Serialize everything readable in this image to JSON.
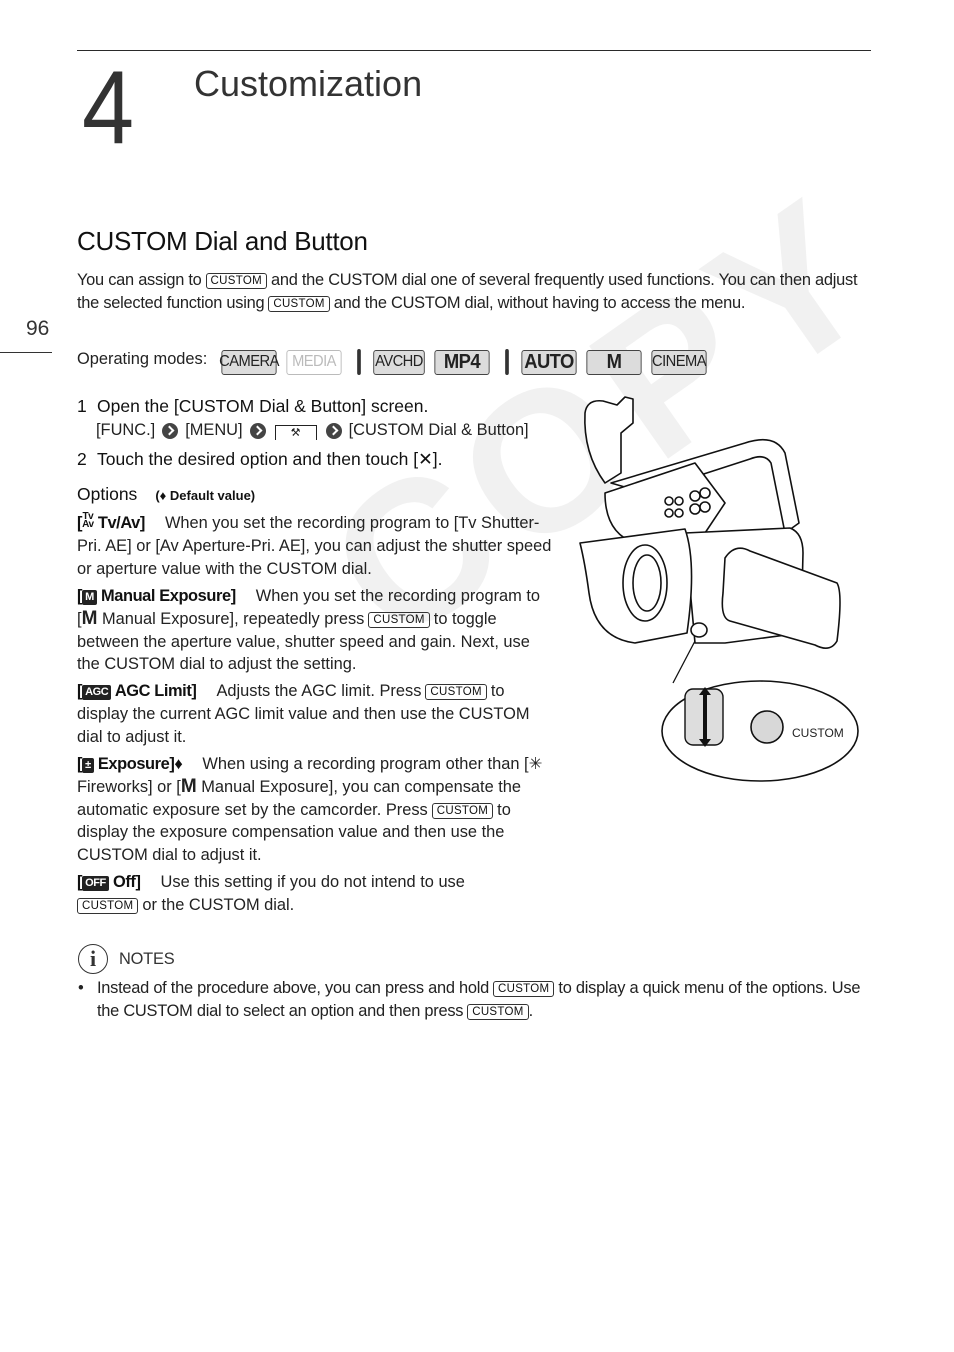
{
  "header": {
    "chapter_number": "4",
    "chapter_title": "Customization",
    "page_number": "96"
  },
  "section": {
    "title": "CUSTOM Dial and Button",
    "intro": {
      "part1": "You can assign to",
      "button": "CUSTOM",
      "part2": "and the CUSTOM dial one of several frequently used functions. You can then adjust the selected function using",
      "part3": "and the CUSTOM dial, without having to access the menu."
    }
  },
  "operating_modes": {
    "label": "Operating modes:",
    "modes": [
      {
        "label": "CAMERA",
        "active": true
      },
      {
        "label": "MEDIA",
        "active": false
      },
      {
        "label": "AVCHD",
        "active": true
      },
      {
        "label": "MP4",
        "active": true
      },
      {
        "label": "AUTO",
        "active": true
      },
      {
        "label": "M",
        "active": true
      },
      {
        "label": "CINEMA",
        "active": true
      }
    ]
  },
  "steps": [
    {
      "number": "1",
      "text": "Open the [CUSTOM Dial & Button] screen."
    },
    {
      "number": "2",
      "text_before": "Touch the desired option and then touch [",
      "icon": "✕",
      "text_after": "]."
    }
  ],
  "menu_path": {
    "items": [
      "[FUNC.]",
      "[MENU]",
      "[CUSTOM Dial & Button]"
    ],
    "tab_icon": "wrench-icon"
  },
  "options": {
    "heading": "Options",
    "default_note": "(♦ Default value)",
    "items": [
      {
        "icon": "TvAv",
        "name": "Tv/Av]",
        "text": "When you set the recording program to [Tv Shutter-Pri. AE] or [Av Aperture-Pri. AE], you can adjust the shutter speed or aperture value with the CUSTOM dial."
      },
      {
        "icon": "M",
        "name": "Manual Exposure]",
        "text_a": "When you set the recording program to [",
        "text_b": "Manual Exposure], repeatedly press",
        "button": "CUSTOM",
        "text_c": "to toggle between the aperture value, shutter speed and gain. Next, use the CUSTOM dial to adjust the setting."
      },
      {
        "icon": "AGC",
        "name": "AGC Limit]",
        "text_a": "Adjusts the AGC limit. Press",
        "button": "CUSTOM",
        "text_b": "to display the current AGC limit value and then use the CUSTOM dial to adjust it."
      },
      {
        "icon": "±",
        "name": "Exposure]♦",
        "text_a": "When using a recording program other than [",
        "fireworks": "✳",
        "text_b": "Fireworks] or [",
        "text_c": "Manual Exposure], you can compensate the automatic exposure set by the camcorder. Press",
        "button": "CUSTOM",
        "text_d": "to display the exposure compensation value and then use the CUSTOM dial to adjust it."
      },
      {
        "icon": "OFF",
        "name": "Off]",
        "text_a": "Use this setting if you do not intend to use",
        "button": "CUSTOM",
        "text_b": "or the CUSTOM dial."
      }
    ]
  },
  "notes": {
    "heading": "NOTES",
    "items": [
      {
        "text_a": "Instead of the procedure above, you can press and hold",
        "button": "CUSTOM",
        "text_b": "to display a quick menu of the options. Use the CUSTOM dial to select an option and then press",
        "text_c": "."
      }
    ]
  },
  "illustration": {
    "callout_label": "CUSTOM"
  },
  "watermark": "COPY"
}
